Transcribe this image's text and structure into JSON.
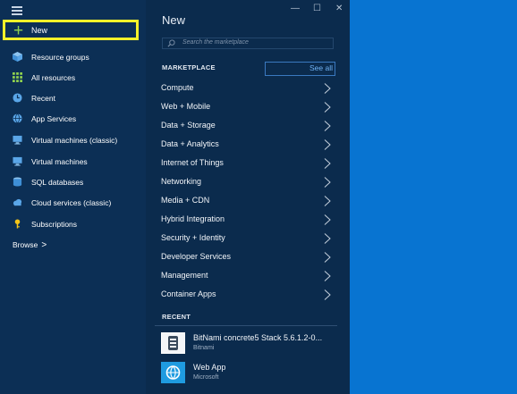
{
  "nav": {
    "new_label": "New",
    "items": [
      {
        "label": "Resource groups",
        "icon": "cube-icon"
      },
      {
        "label": "All resources",
        "icon": "grid-icon"
      },
      {
        "label": "Recent",
        "icon": "clock-icon"
      },
      {
        "label": "App Services",
        "icon": "globe-icon"
      },
      {
        "label": "Virtual machines (classic)",
        "icon": "monitor-icon"
      },
      {
        "label": "Virtual machines",
        "icon": "monitor-icon"
      },
      {
        "label": "SQL databases",
        "icon": "database-icon"
      },
      {
        "label": "Cloud services (classic)",
        "icon": "cloud-icon"
      },
      {
        "label": "Subscriptions",
        "icon": "key-icon"
      }
    ],
    "browse_label": "Browse",
    "browse_chevron": ">"
  },
  "blade": {
    "title": "New",
    "minimize": "—",
    "maximize": "☐",
    "close": "✕",
    "search_placeholder": "Search the marketplace",
    "marketplace_label": "MARKETPLACE",
    "see_all": "See all",
    "categories": [
      "Compute",
      "Web + Mobile",
      "Data + Storage",
      "Data + Analytics",
      "Internet of Things",
      "Networking",
      "Media + CDN",
      "Hybrid Integration",
      "Security + Identity",
      "Developer Services",
      "Management",
      "Container Apps"
    ],
    "recent_label": "RECENT",
    "recent": [
      {
        "name": "BitNami concrete5 Stack 5.6.1.2-0...",
        "publisher": "Bitnami",
        "tile_color": "#ffffff"
      },
      {
        "name": "Web App",
        "publisher": "Microsoft",
        "tile_color": "#1f9be0"
      }
    ]
  },
  "colors": {
    "nav_bg": "#0c2f55",
    "blade_bg": "#0b2b4d",
    "highlight": "#f5f02a",
    "accent": "#0874d1"
  }
}
